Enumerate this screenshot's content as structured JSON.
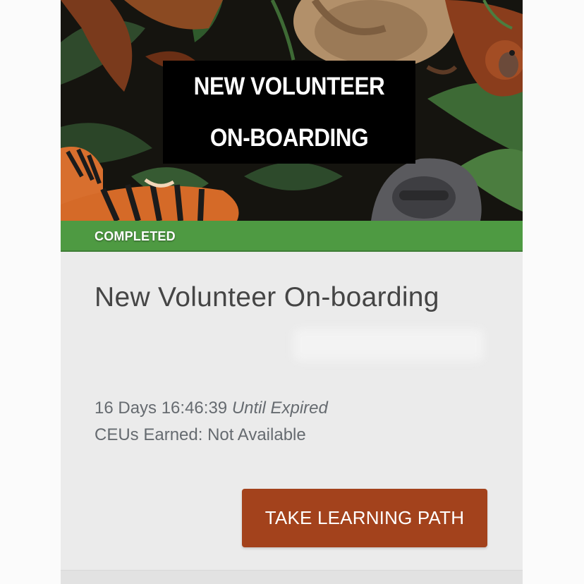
{
  "banner": {
    "title_line1": "NEW VOLUNTEER",
    "title_line2": "ON-BOARDING",
    "status": "COMPLETED",
    "status_color": "#4e9a42"
  },
  "course": {
    "title": "New Volunteer On-boarding",
    "countdown": "16 Days 16:46:39",
    "countdown_suffix": "Until Expired",
    "ceus": "CEUs Earned: Not Available"
  },
  "actions": {
    "primary_label": "TAKE LEARNING PATH",
    "primary_color": "#a3421c"
  }
}
